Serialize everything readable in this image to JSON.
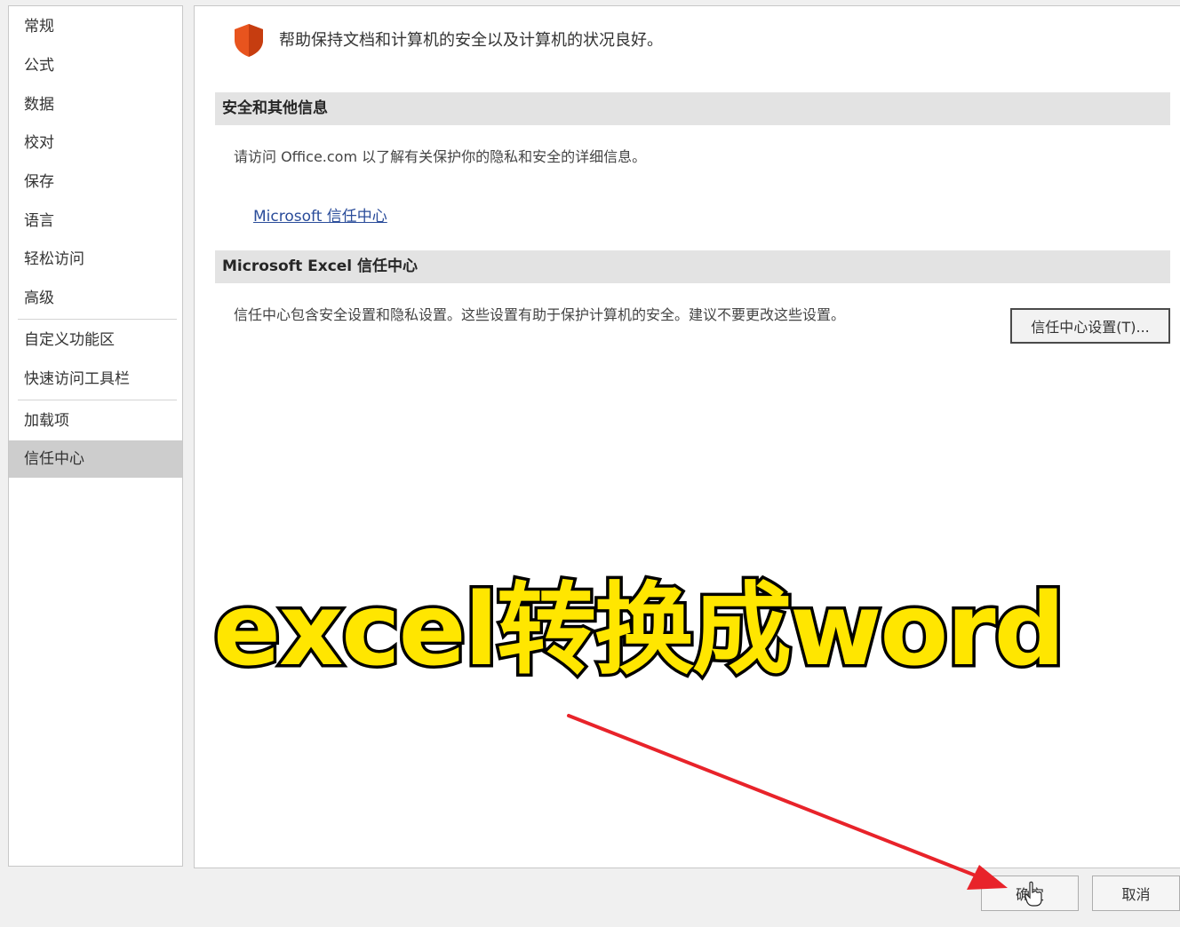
{
  "sidebar": {
    "items": [
      {
        "label": "常规"
      },
      {
        "label": "公式"
      },
      {
        "label": "数据"
      },
      {
        "label": "校对"
      },
      {
        "label": "保存"
      },
      {
        "label": "语言"
      },
      {
        "label": "轻松访问"
      },
      {
        "label": "高级"
      },
      {
        "label": "自定义功能区"
      },
      {
        "label": "快速访问工具栏"
      },
      {
        "label": "加载项"
      },
      {
        "label": "信任中心",
        "selected": true
      }
    ]
  },
  "main": {
    "intro": "帮助保持文档和计算机的安全以及计算机的状况良好。",
    "section1": {
      "title": "安全和其他信息",
      "text": "请访问 Office.com 以了解有关保护你的隐私和安全的详细信息。",
      "link": "Microsoft 信任中心"
    },
    "section2": {
      "title": "Microsoft Excel 信任中心",
      "text": "信任中心包含安全设置和隐私设置。这些设置有助于保护计算机的安全。建议不要更改这些设置。",
      "button": "信任中心设置(T)..."
    }
  },
  "footer": {
    "ok": "确定",
    "cancel": "取消"
  },
  "overlay": {
    "caption": "excel转换成word"
  },
  "colors": {
    "shield": "#e8541e",
    "link": "#2a4c9a",
    "caption_fill": "#ffe600",
    "caption_stroke": "#000000",
    "arrow": "#e8232a",
    "selected_nav": "#cdcdcd"
  },
  "icons": {
    "shield": "shield-icon",
    "cursor": "hand-cursor-icon"
  }
}
